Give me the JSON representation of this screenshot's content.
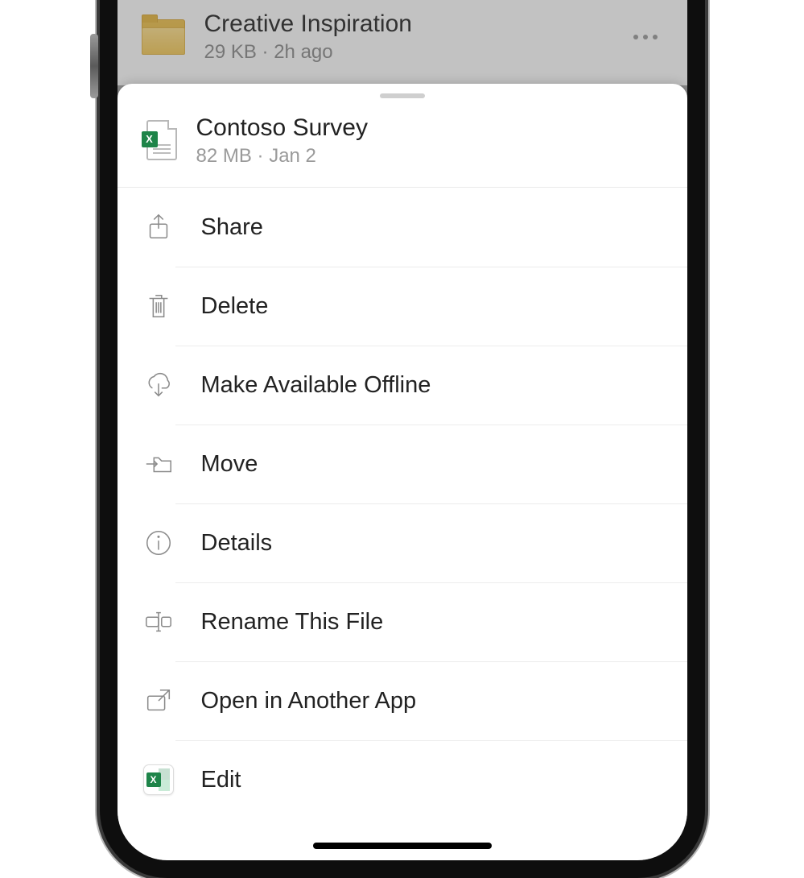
{
  "background": {
    "folder_name": "Creative Inspiration",
    "folder_meta": "29 KB · 2h ago"
  },
  "sheet": {
    "file_name": "Contoso Survey",
    "file_meta": "82 MB · Jan 2"
  },
  "actions": {
    "share": "Share",
    "delete": "Delete",
    "offline": "Make Available Offline",
    "move": "Move",
    "details": "Details",
    "rename": "Rename This File",
    "open_other": "Open in Another App",
    "edit": "Edit"
  }
}
